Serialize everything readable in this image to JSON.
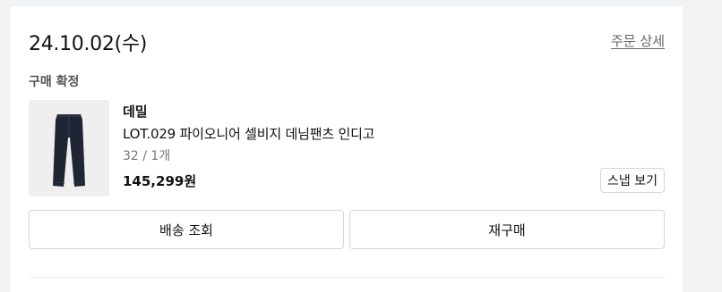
{
  "order": {
    "date": "24.10.02(수)",
    "detail_link": "주문 상세",
    "status": "구매 확정"
  },
  "product": {
    "image_icon": "jeans-icon",
    "brand": "데밀",
    "name": "LOT.029 파이오니어 셀비지 데님팬츠 인디고",
    "options": "32 / 1개",
    "price": "145,299원",
    "snap_button": "스냅 보기"
  },
  "actions": {
    "track_delivery": "배송 조회",
    "reorder": "재구매"
  }
}
